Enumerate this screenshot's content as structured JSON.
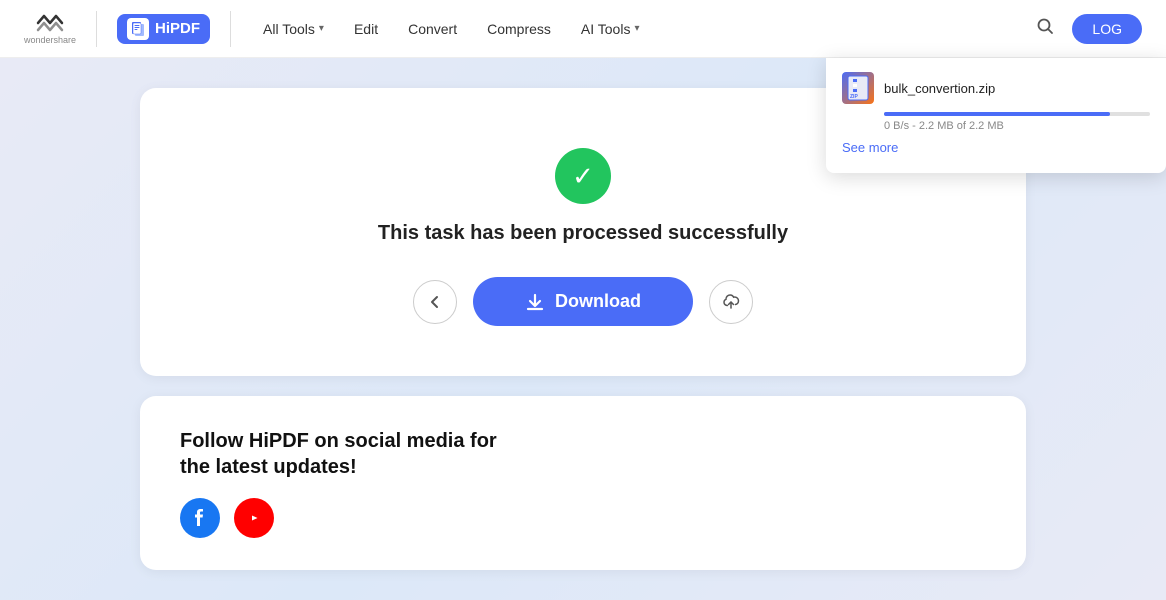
{
  "header": {
    "wondershare_label": "wondershare",
    "hipdf_label": "HiPDF",
    "nav_items": [
      {
        "label": "All Tools",
        "has_dropdown": true
      },
      {
        "label": "Edit",
        "has_dropdown": false
      },
      {
        "label": "Convert",
        "has_dropdown": false
      },
      {
        "label": "Compress",
        "has_dropdown": false
      },
      {
        "label": "AI Tools",
        "has_dropdown": true
      }
    ],
    "login_label": "LOG"
  },
  "card": {
    "success_message": "This task has been processed successfully",
    "download_label": "Download"
  },
  "social": {
    "title": "Follow HiPDF on social media for the latest updates!"
  },
  "download_popup": {
    "filename": "bulk_convertion.zip",
    "progress_text": "0 B/s - 2.2 MB of 2.2 MB",
    "see_more_label": "See more",
    "progress_percent": 85
  }
}
